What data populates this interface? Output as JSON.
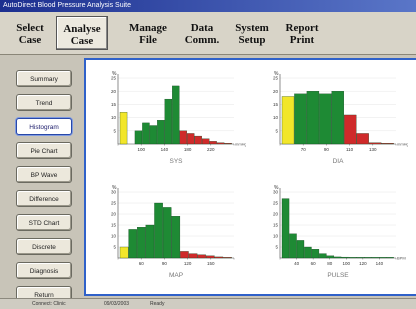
{
  "window": {
    "title": "AutoDirect Blood Pressure Analysis Suite"
  },
  "menu": [
    {
      "label": "Select\nCase"
    },
    {
      "label": "Analyse\nCase",
      "active": true
    },
    {
      "label": "Manage\nFile"
    },
    {
      "label": "Data\nComm."
    },
    {
      "label": "System\nSetup"
    },
    {
      "label": "Report\nPrint"
    }
  ],
  "sidebar": {
    "items": [
      {
        "label": "Summary"
      },
      {
        "label": "Trend"
      },
      {
        "label": "Histogram",
        "active": true
      },
      {
        "label": "Pie Chart"
      },
      {
        "label": "BP Wave"
      },
      {
        "label": "Difference"
      },
      {
        "label": "STD Chart"
      },
      {
        "label": "Discrete"
      },
      {
        "label": "Diagnosis"
      },
      {
        "label": "Return"
      }
    ]
  },
  "colors": {
    "yellow": "#f2e62a",
    "green": "#1e8a34",
    "red": "#cf2a2a",
    "accent": "#2f61c9"
  },
  "chart_data": [
    {
      "type": "bar",
      "title": "SYS",
      "ylabel": "%",
      "xlabel": "mmHg",
      "ylim": [
        0,
        25
      ],
      "yticks": [
        "25",
        "20",
        "15",
        "10",
        "5"
      ],
      "xticks": [
        "",
        "100",
        "140",
        "180",
        "220",
        ""
      ],
      "values": [
        12,
        0,
        5,
        8,
        7,
        9,
        17,
        22,
        5,
        4,
        3,
        2,
        1,
        0.5,
        0.3
      ],
      "colors": [
        "yellow",
        "yellow",
        "green",
        "green",
        "green",
        "green",
        "green",
        "green",
        "red",
        "red",
        "red",
        "red",
        "red",
        "red",
        "red"
      ]
    },
    {
      "type": "bar",
      "title": "DIA",
      "ylabel": "%",
      "xlabel": "mmHg",
      "ylim": [
        0,
        25
      ],
      "yticks": [
        "25",
        "20",
        "15",
        "10",
        "5"
      ],
      "xticks": [
        "",
        "70",
        "90",
        "110",
        "130",
        ""
      ],
      "values": [
        18,
        19,
        20,
        19,
        20,
        11,
        4,
        0.5,
        0.3
      ],
      "colors": [
        "yellow",
        "green",
        "green",
        "green",
        "green",
        "red",
        "red",
        "red",
        "red"
      ]
    },
    {
      "type": "bar",
      "title": "MAP",
      "ylabel": "%",
      "xlabel": "",
      "ylim": [
        0,
        30
      ],
      "yticks": [
        "30",
        "25",
        "20",
        "15",
        "10",
        "5"
      ],
      "xticks": [
        "",
        "60",
        "90",
        "120",
        "150",
        ""
      ],
      "values": [
        5,
        13,
        14,
        15,
        25,
        23,
        19,
        3,
        2,
        1.5,
        1,
        0.5,
        0.3
      ],
      "colors": [
        "yellow",
        "green",
        "green",
        "green",
        "green",
        "green",
        "green",
        "red",
        "red",
        "red",
        "red",
        "red",
        "red"
      ]
    },
    {
      "type": "bar",
      "title": "PULSE",
      "ylabel": "%",
      "xlabel": "BPM",
      "ylim": [
        0,
        30
      ],
      "yticks": [
        "30",
        "25",
        "20",
        "15",
        "10",
        "5"
      ],
      "xticks": [
        "",
        "40",
        "60",
        "80",
        "100",
        "120",
        "140",
        ""
      ],
      "values": [
        27,
        11,
        8,
        5,
        4,
        2,
        1,
        0.5,
        0.4,
        0.3,
        0.3,
        0.3,
        0.3,
        0.3,
        0.3
      ],
      "colors": [
        "green",
        "green",
        "green",
        "green",
        "green",
        "green",
        "green",
        "green",
        "green",
        "green",
        "green",
        "green",
        "green",
        "green",
        "green"
      ]
    }
  ],
  "statusbar": {
    "left": "Connect: Clinic",
    "mid": "09/03/2003",
    "right": "Ready"
  }
}
